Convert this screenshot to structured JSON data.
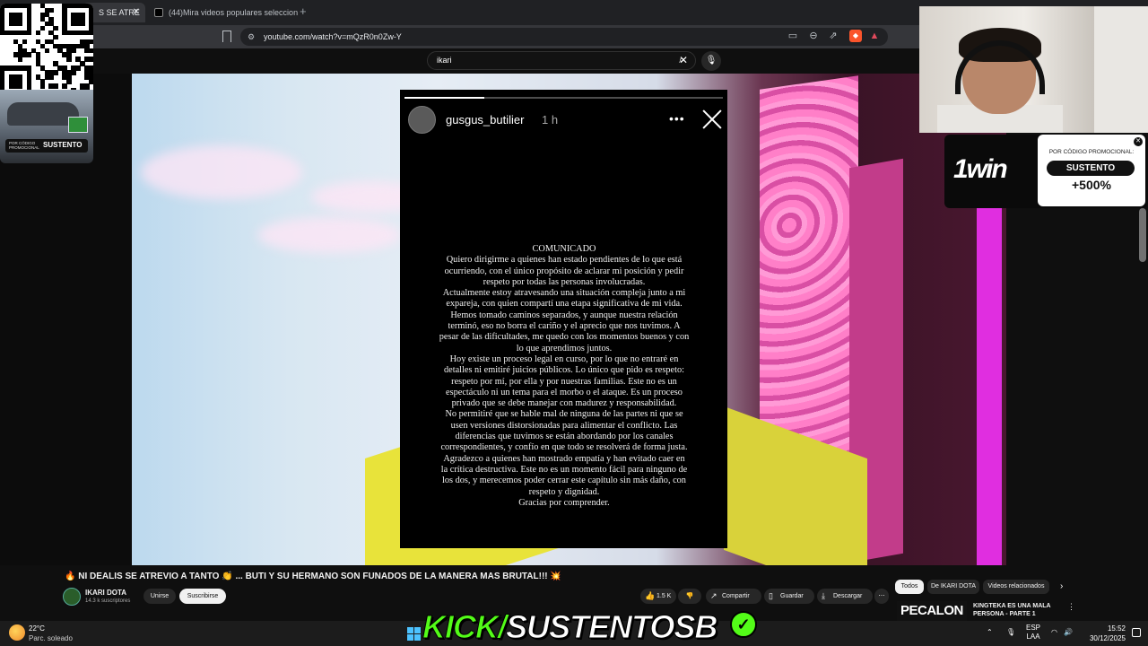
{
  "browser": {
    "tabs": [
      {
        "label": "S SE ATRE",
        "active": true
      },
      {
        "label": "(44)Mira videos populares seleccion",
        "active": false
      }
    ],
    "url": "youtube.com/watch?v=mQzR0n0Zw-Y"
  },
  "youtube": {
    "search_value": "ikari",
    "video_title": "🔥 NI DEALIS SE ATREVIO A TANTO 👏 ... BUTI Y SU HERMANO SON FUNADOS DE LA MANERA MAS BRUTAL!!! 💥",
    "channel_name": "IKARI DOTA",
    "channel_subs": "14.3 k suscriptores",
    "join_label": "Unirse",
    "subscribe_label": "Suscribirse",
    "actions": {
      "likes": "1.5 K",
      "share": "Compartir",
      "save": "Guardar",
      "download": "Descargar"
    },
    "chips": [
      "Todos",
      "De IKARI DOTA",
      "Videos relacionados"
    ],
    "next_video": {
      "thumb_text": "PECALON",
      "title": "KINGTEKA ES UNA MALA PERSONA - PARTE 1"
    },
    "video_progress": 0.0
  },
  "story": {
    "username": "gusgus_butilier",
    "time": "1 h",
    "progress": 0.25,
    "lines": [
      "COMUNICADO",
      "Quiero dirigirme a quienes han estado pendientes de lo que está",
      "ocurriendo, con el único propósito de aclarar mi posición y pedir",
      "respeto por todas las personas involucradas.",
      "Actualmente estoy atravesando una situación compleja junto a mi",
      "expareja, con quien compartí una etapa significativa de mi vida.",
      "Hemos tomado caminos separados, y aunque nuestra relación",
      "terminó, eso no borra el cariño y el aprecio que nos tuvimos. A",
      "pesar de las dificultades, me quedo con los momentos buenos y con",
      "lo que aprendimos juntos.",
      "Hoy existe un proceso legal en curso, por lo que no entraré en",
      "detalles ni emitiré juicios públicos. Lo único que pido es respeto:",
      "respeto por mí, por ella y por nuestras familias. Este no es un",
      "espectáculo ni un tema para el morbo o el ataque. Es un proceso",
      "privado que se debe manejar con madurez y responsabilidad.",
      "No permitiré que se hable mal de ninguna de las partes ni que se",
      "usen versiones distorsionadas para alimentar el conflicto. Las",
      "diferencias que tuvimos se están abordando por los canales",
      "correspondientes, y confío en que todo se resolverá de forma justa.",
      "Agradezco a quienes han mostrado empatía y han evitado caer en",
      "la crítica destructiva. Este no es un momento fácil para ninguno de",
      "los dos, y merecemos poder cerrar este capítulo sin más daño, con",
      "respeto y dignidad.",
      "Gracias por comprender."
    ]
  },
  "overlays": {
    "promo_small": "POR CÓDIGO PROMOCIONAL",
    "promo_code": "SUSTENTO",
    "win1_logo": "1win",
    "win1_small": "POR CÓDIGO PROMOCIONAL:",
    "win1_code": "SUSTENTO",
    "win1_pct": "+500%",
    "kick_prefix": "KICK/",
    "kick_name": "SUSTENTOSB"
  },
  "taskbar": {
    "temp": "22°C",
    "weather": "Parc. soleado",
    "lang1": "ESP",
    "lang2": "LAA",
    "time": "15:52",
    "date": "30/12/2025"
  },
  "colors": {
    "kick_green": "#53fc18",
    "brand_red": "#ff0000"
  }
}
